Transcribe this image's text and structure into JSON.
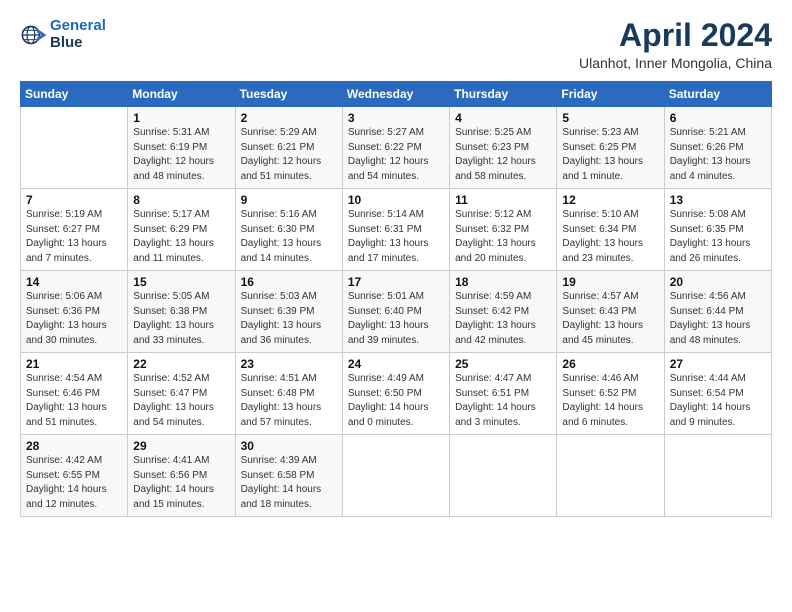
{
  "logo": {
    "line1": "General",
    "line2": "Blue"
  },
  "title": "April 2024",
  "subtitle": "Ulanhot, Inner Mongolia, China",
  "weekdays": [
    "Sunday",
    "Monday",
    "Tuesday",
    "Wednesday",
    "Thursday",
    "Friday",
    "Saturday"
  ],
  "weeks": [
    [
      {
        "day": "",
        "sunrise": "",
        "sunset": "",
        "daylight": ""
      },
      {
        "day": "1",
        "sunrise": "Sunrise: 5:31 AM",
        "sunset": "Sunset: 6:19 PM",
        "daylight": "Daylight: 12 hours and 48 minutes."
      },
      {
        "day": "2",
        "sunrise": "Sunrise: 5:29 AM",
        "sunset": "Sunset: 6:21 PM",
        "daylight": "Daylight: 12 hours and 51 minutes."
      },
      {
        "day": "3",
        "sunrise": "Sunrise: 5:27 AM",
        "sunset": "Sunset: 6:22 PM",
        "daylight": "Daylight: 12 hours and 54 minutes."
      },
      {
        "day": "4",
        "sunrise": "Sunrise: 5:25 AM",
        "sunset": "Sunset: 6:23 PM",
        "daylight": "Daylight: 12 hours and 58 minutes."
      },
      {
        "day": "5",
        "sunrise": "Sunrise: 5:23 AM",
        "sunset": "Sunset: 6:25 PM",
        "daylight": "Daylight: 13 hours and 1 minute."
      },
      {
        "day": "6",
        "sunrise": "Sunrise: 5:21 AM",
        "sunset": "Sunset: 6:26 PM",
        "daylight": "Daylight: 13 hours and 4 minutes."
      }
    ],
    [
      {
        "day": "7",
        "sunrise": "Sunrise: 5:19 AM",
        "sunset": "Sunset: 6:27 PM",
        "daylight": "Daylight: 13 hours and 7 minutes."
      },
      {
        "day": "8",
        "sunrise": "Sunrise: 5:17 AM",
        "sunset": "Sunset: 6:29 PM",
        "daylight": "Daylight: 13 hours and 11 minutes."
      },
      {
        "day": "9",
        "sunrise": "Sunrise: 5:16 AM",
        "sunset": "Sunset: 6:30 PM",
        "daylight": "Daylight: 13 hours and 14 minutes."
      },
      {
        "day": "10",
        "sunrise": "Sunrise: 5:14 AM",
        "sunset": "Sunset: 6:31 PM",
        "daylight": "Daylight: 13 hours and 17 minutes."
      },
      {
        "day": "11",
        "sunrise": "Sunrise: 5:12 AM",
        "sunset": "Sunset: 6:32 PM",
        "daylight": "Daylight: 13 hours and 20 minutes."
      },
      {
        "day": "12",
        "sunrise": "Sunrise: 5:10 AM",
        "sunset": "Sunset: 6:34 PM",
        "daylight": "Daylight: 13 hours and 23 minutes."
      },
      {
        "day": "13",
        "sunrise": "Sunrise: 5:08 AM",
        "sunset": "Sunset: 6:35 PM",
        "daylight": "Daylight: 13 hours and 26 minutes."
      }
    ],
    [
      {
        "day": "14",
        "sunrise": "Sunrise: 5:06 AM",
        "sunset": "Sunset: 6:36 PM",
        "daylight": "Daylight: 13 hours and 30 minutes."
      },
      {
        "day": "15",
        "sunrise": "Sunrise: 5:05 AM",
        "sunset": "Sunset: 6:38 PM",
        "daylight": "Daylight: 13 hours and 33 minutes."
      },
      {
        "day": "16",
        "sunrise": "Sunrise: 5:03 AM",
        "sunset": "Sunset: 6:39 PM",
        "daylight": "Daylight: 13 hours and 36 minutes."
      },
      {
        "day": "17",
        "sunrise": "Sunrise: 5:01 AM",
        "sunset": "Sunset: 6:40 PM",
        "daylight": "Daylight: 13 hours and 39 minutes."
      },
      {
        "day": "18",
        "sunrise": "Sunrise: 4:59 AM",
        "sunset": "Sunset: 6:42 PM",
        "daylight": "Daylight: 13 hours and 42 minutes."
      },
      {
        "day": "19",
        "sunrise": "Sunrise: 4:57 AM",
        "sunset": "Sunset: 6:43 PM",
        "daylight": "Daylight: 13 hours and 45 minutes."
      },
      {
        "day": "20",
        "sunrise": "Sunrise: 4:56 AM",
        "sunset": "Sunset: 6:44 PM",
        "daylight": "Daylight: 13 hours and 48 minutes."
      }
    ],
    [
      {
        "day": "21",
        "sunrise": "Sunrise: 4:54 AM",
        "sunset": "Sunset: 6:46 PM",
        "daylight": "Daylight: 13 hours and 51 minutes."
      },
      {
        "day": "22",
        "sunrise": "Sunrise: 4:52 AM",
        "sunset": "Sunset: 6:47 PM",
        "daylight": "Daylight: 13 hours and 54 minutes."
      },
      {
        "day": "23",
        "sunrise": "Sunrise: 4:51 AM",
        "sunset": "Sunset: 6:48 PM",
        "daylight": "Daylight: 13 hours and 57 minutes."
      },
      {
        "day": "24",
        "sunrise": "Sunrise: 4:49 AM",
        "sunset": "Sunset: 6:50 PM",
        "daylight": "Daylight: 14 hours and 0 minutes."
      },
      {
        "day": "25",
        "sunrise": "Sunrise: 4:47 AM",
        "sunset": "Sunset: 6:51 PM",
        "daylight": "Daylight: 14 hours and 3 minutes."
      },
      {
        "day": "26",
        "sunrise": "Sunrise: 4:46 AM",
        "sunset": "Sunset: 6:52 PM",
        "daylight": "Daylight: 14 hours and 6 minutes."
      },
      {
        "day": "27",
        "sunrise": "Sunrise: 4:44 AM",
        "sunset": "Sunset: 6:54 PM",
        "daylight": "Daylight: 14 hours and 9 minutes."
      }
    ],
    [
      {
        "day": "28",
        "sunrise": "Sunrise: 4:42 AM",
        "sunset": "Sunset: 6:55 PM",
        "daylight": "Daylight: 14 hours and 12 minutes."
      },
      {
        "day": "29",
        "sunrise": "Sunrise: 4:41 AM",
        "sunset": "Sunset: 6:56 PM",
        "daylight": "Daylight: 14 hours and 15 minutes."
      },
      {
        "day": "30",
        "sunrise": "Sunrise: 4:39 AM",
        "sunset": "Sunset: 6:58 PM",
        "daylight": "Daylight: 14 hours and 18 minutes."
      },
      {
        "day": "",
        "sunrise": "",
        "sunset": "",
        "daylight": ""
      },
      {
        "day": "",
        "sunrise": "",
        "sunset": "",
        "daylight": ""
      },
      {
        "day": "",
        "sunrise": "",
        "sunset": "",
        "daylight": ""
      },
      {
        "day": "",
        "sunrise": "",
        "sunset": "",
        "daylight": ""
      }
    ]
  ]
}
